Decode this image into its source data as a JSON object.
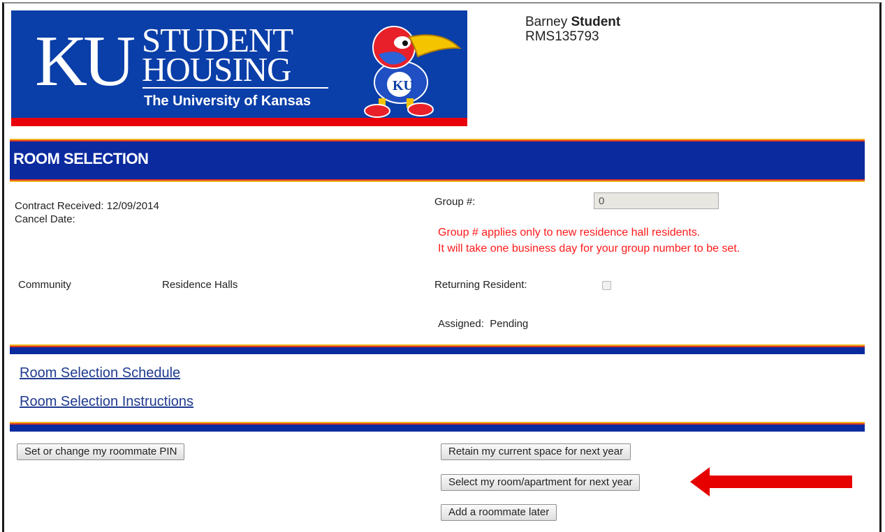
{
  "banner": {
    "letters": "KU",
    "line1": "STUDENT",
    "line2": "HOUSING",
    "subtitle": "The University of Kansas",
    "colors": {
      "blue": "#0a3ea8",
      "red": "#e8000b"
    }
  },
  "user": {
    "first_name": "Barney",
    "last_name": "Student",
    "id": "RMS135793"
  },
  "section": {
    "title": "ROOM SELECTION"
  },
  "contract": {
    "received_label": "Contract Received:",
    "received_value": "12/09/2014",
    "cancel_label": "Cancel Date:",
    "cancel_value": ""
  },
  "group": {
    "label": "Group #:",
    "value": "0",
    "note_line1": "Group # applies only to new residence hall residents.",
    "note_line2": "It will take one business day for your group number to be set."
  },
  "community": {
    "label": "Community",
    "value": "Residence Halls"
  },
  "returning": {
    "label": "Returning Resident:",
    "checked": false
  },
  "assigned": {
    "label": "Assigned:",
    "value": "Pending"
  },
  "links": {
    "schedule": "Room Selection Schedule",
    "instructions": "Room Selection Instructions"
  },
  "buttons": {
    "roommate_pin": "Set or change my roommate PIN",
    "retain_space": "Retain my current space for next year",
    "select_room": "Select my room/apartment for next year",
    "add_roommate": "Add a roommate later"
  },
  "colors": {
    "bar_blue": "#0a2a9e",
    "bar_gold": "#f2b51d",
    "bar_red": "#d9332c",
    "note_red": "#ff1a1a",
    "arrow_red": "#e60000"
  }
}
